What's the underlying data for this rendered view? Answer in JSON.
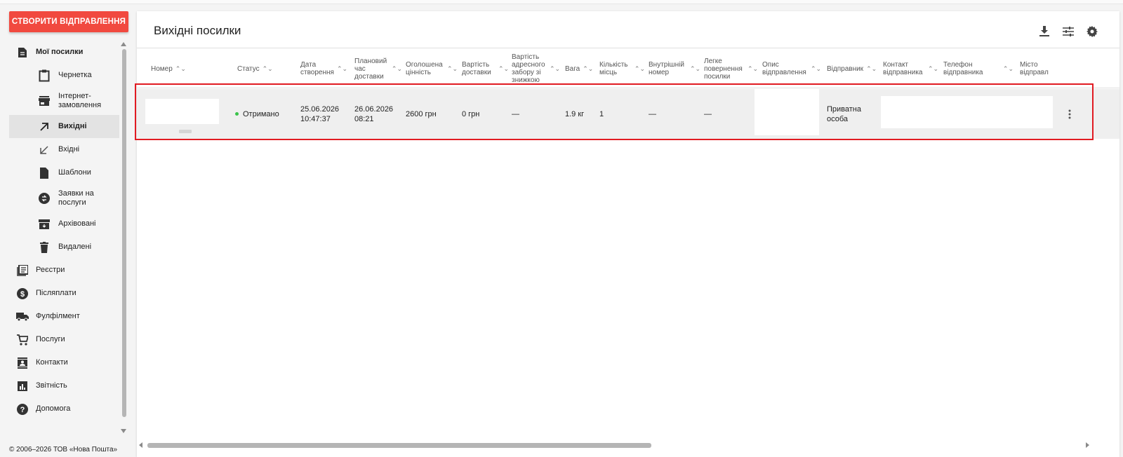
{
  "sidebar": {
    "create_button": "СТВОРИТИ ВІДПРАВЛЕННЯ",
    "items": [
      {
        "label": "Мої посилки",
        "icon": "document-icon"
      },
      {
        "label": "Чернетка",
        "icon": "clipboard-icon"
      },
      {
        "label": "Інтернет-замовлення",
        "icon": "store-icon"
      },
      {
        "label": "Вихідні",
        "icon": "arrow-up-right-icon"
      },
      {
        "label": "Вхідні",
        "icon": "arrow-down-left-icon"
      },
      {
        "label": "Шаблони",
        "icon": "file-icon"
      },
      {
        "label": "Заявки на послуги",
        "icon": "service-request-icon"
      },
      {
        "label": "Архівовані",
        "icon": "archive-icon"
      },
      {
        "label": "Видалені",
        "icon": "trash-icon"
      },
      {
        "label": "Реєстри",
        "icon": "registry-icon"
      },
      {
        "label": "Післяплати",
        "icon": "dollar-icon"
      },
      {
        "label": "Фулфілмент",
        "icon": "truck-icon"
      },
      {
        "label": "Послуги",
        "icon": "cart-icon"
      },
      {
        "label": "Контакти",
        "icon": "contacts-icon"
      },
      {
        "label": "Звітність",
        "icon": "chart-icon"
      },
      {
        "label": "Допомога",
        "icon": "help-icon"
      }
    ],
    "copyright": "© 2006–2026 ТОВ «Нова Пошта»"
  },
  "main": {
    "title": "Вихідні посилки",
    "tools": [
      "download-icon",
      "filter-settings-icon",
      "gear-icon"
    ],
    "columns": [
      "Номер",
      "Статус",
      "Дата створення",
      "Плановий час доставки",
      "Оголошена цінність",
      "Вартість доставки",
      "Вартість адресного забору зі знижкою",
      "Вага",
      "Кількість місць",
      "Внутрішній номер",
      "Легке повернення посилки",
      "Опис відправлення",
      "Відправник",
      "Контакт відправника",
      "Телефон відправника",
      "Місто відправл"
    ],
    "row": {
      "status": "Отримано",
      "status_color": "#3ac34a",
      "created": "25.06.2026 10:47:37",
      "planned": "26.06.2026 08:21",
      "declared_value": "2600 грн",
      "delivery_cost": "0 грн",
      "pickup_cost": "—",
      "weight": "1.9 кг",
      "places": "1",
      "internal_number": "—",
      "easy_return": "—",
      "sender": "Приватна особа"
    }
  },
  "colors": {
    "accent": "#f1493f",
    "highlight": "#e11b22"
  }
}
